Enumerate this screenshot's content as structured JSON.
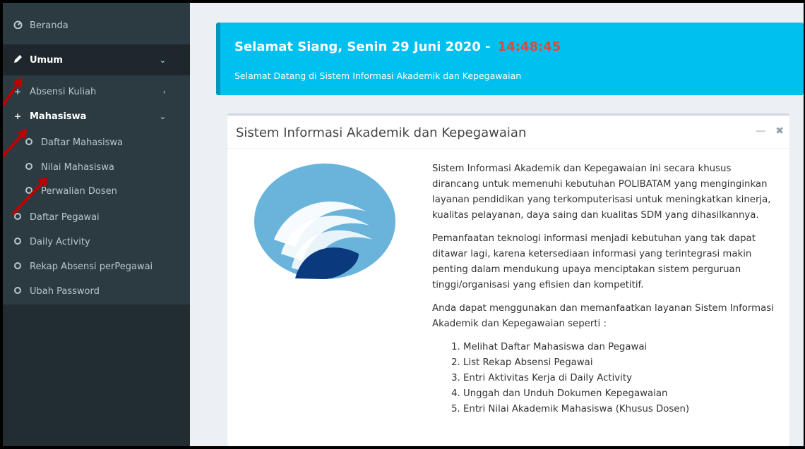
{
  "sidebar": {
    "items": [
      {
        "label": "Beranda",
        "icon": "dashboard-icon"
      },
      {
        "label": "Umum",
        "icon": "pencil-icon"
      },
      {
        "label": "Absensi Kuliah",
        "icon": "plus-icon"
      },
      {
        "label": "Mahasiswa",
        "icon": "plus-icon"
      },
      {
        "label": "Daftar Mahasiswa",
        "icon": "circle-icon"
      },
      {
        "label": "Nilai Mahasiswa",
        "icon": "circle-icon"
      },
      {
        "label": "Perwalian Dosen",
        "icon": "circle-icon"
      },
      {
        "label": "Daftar Pegawai",
        "icon": "circle-icon"
      },
      {
        "label": "Daily Activity",
        "icon": "circle-icon"
      },
      {
        "label": "Rekap Absensi perPegawai",
        "icon": "circle-icon"
      },
      {
        "label": "Ubah Password",
        "icon": "circle-icon"
      }
    ]
  },
  "callout": {
    "greeting": "Selamat Siang, Senin 29 Juni 2020  -",
    "time": "14:48:45",
    "subtitle": "Selamat Datang di Sistem Informasi Akademik dan Kepegawaian"
  },
  "box": {
    "title": "Sistem Informasi Akademik dan Kepegawaian",
    "minimize": "—",
    "close": "✖",
    "paragraphs": [
      "Sistem Informasi Akademik dan Kepegawaian ini secara khusus dirancang untuk memenuhi kebutuhan POLIBATAM yang menginginkan layanan pendidikan yang terkomputerisasi untuk meningkatkan kinerja, kualitas pelayanan, daya saing dan kualitas SDM yang dihasilkannya.",
      "Pemanfaatan teknologi informasi menjadi kebutuhan yang tak dapat ditawar lagi, karena ketersediaan informasi yang terintegrasi makin penting dalam mendukung upaya menciptakan sistem perguruan tinggi/organisasi yang efisien dan kompetitif.",
      "Anda dapat menggunakan dan memanfaatkan layanan Sistem Informasi Akademik dan Kepegawaian seperti :"
    ],
    "list": [
      "Melihat Daftar Mahasiswa dan Pegawai",
      "List Rekap Absensi Pegawai",
      "Entri Aktivitas Kerja di Daily Activity",
      "Unggah dan Unduh Dokumen Kepegawaian",
      "Entri Nilai Akademik Mahasiswa (Khusus Dosen)"
    ]
  },
  "colors": {
    "sidebar": "#222d32",
    "callout": "#00c0ef",
    "time": "#dd4b39",
    "arrow": "#c00000"
  }
}
